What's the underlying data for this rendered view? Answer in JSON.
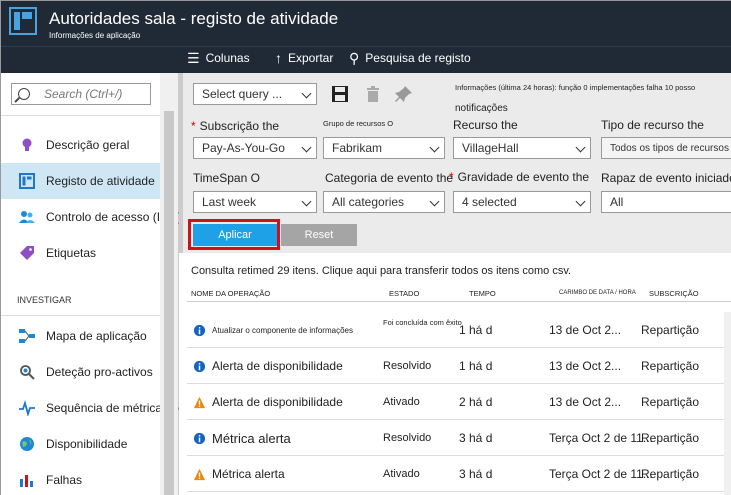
{
  "header": {
    "title": "Autoridades sala - registo de atividade",
    "subtitle": "Informações de aplicação"
  },
  "toolbar": {
    "columns": "Colunas",
    "export": "Exportar",
    "search_log": "Pesquisa de registo"
  },
  "sidebar": {
    "search_placeholder": "Search (Ctrl+/)",
    "items": [
      {
        "label": "Descrição geral",
        "icon": "lightbulb-icon"
      },
      {
        "label": "Registo de atividade",
        "icon": "activity-log-icon"
      },
      {
        "label": "Controlo de acesso (IAM)",
        "icon": "users-icon"
      },
      {
        "label": "Etiquetas",
        "icon": "tag-icon"
      }
    ],
    "section": "INVESTIGAR",
    "items2": [
      {
        "label": "Mapa de aplicação",
        "icon": "app-map-icon"
      },
      {
        "label": "Deteção pro-activos",
        "icon": "magnifier-icon"
      },
      {
        "label": "Sequência de métricas de Live",
        "icon": "pulse-icon"
      },
      {
        "label": "Disponibilidade",
        "icon": "globe-icon"
      },
      {
        "label": "Falhas",
        "icon": "bar-chart-icon"
      }
    ]
  },
  "filters": {
    "query_select": "Select query ...",
    "info": "Informações (última 24 horas): função 0 implementações falha 10 posso",
    "notifications": "notificações",
    "subscription_label": "Subscrição the",
    "subscription_value": "Pay-As-You-Go",
    "resource_group_label": "Grupo de recursos O",
    "resource_group_value": "Fabrikam",
    "resource_label": "Recurso the",
    "resource_value": "VillageHall",
    "resource_type_label": "Tipo de recurso the",
    "resource_type_value": "Todos os tipos de recursos",
    "timespan_label": "TimeSpan O",
    "timespan_value": "Last week",
    "event_category_label": "Categoria de evento the",
    "event_category_value": "All categories",
    "severity_label": "Gravidade de evento the",
    "severity_value": "4 selected",
    "initiated_label": "Rapaz de evento iniciado",
    "initiated_value": "All",
    "apply": "Aplicar",
    "reset": "Reset"
  },
  "results": {
    "summary": "Consulta retimed 29 itens.  Clique aqui para transferir todos os itens como csv.",
    "headers": {
      "op": "NOME DA OPERAÇÃO",
      "status": "ESTADO",
      "time": "TEMPO",
      "date": "CARIMBO DE DATA / HORA",
      "sub": "SUBSCRIÇÃO"
    },
    "rows": [
      {
        "op": "Atualizar o componente de informações",
        "status": "Foi concluída com êxito",
        "time": "1 há d",
        "date": "13 de Oct 2...",
        "sub": "Repartição",
        "icon": "info-icon",
        "color": "#1565c0"
      },
      {
        "op": "Alerta de disponibilidade",
        "status": "Resolvido",
        "time": "1 há d",
        "date": "13 de Oct 2...",
        "sub": "Repartição",
        "icon": "info-icon",
        "color": "#1565c0"
      },
      {
        "op": "Alerta de disponibilidade",
        "status": "Ativado",
        "time": "2 há d",
        "date": "13 de Oct 2...",
        "sub": "Repartição",
        "icon": "warning-icon",
        "color": "#e8890c"
      },
      {
        "op": "Métrica alerta",
        "status": "Resolvido",
        "time": "3 há d",
        "date": "Terça Oct 2 de 11...",
        "sub": "Repartição",
        "icon": "info-icon",
        "color": "#1565c0"
      },
      {
        "op": "Métrica alerta",
        "status": "Ativado",
        "time": "3 há d",
        "date": "Terça Oct 2 de 11...",
        "sub": "Repartição",
        "icon": "warning-icon",
        "color": "#e8890c"
      }
    ]
  }
}
